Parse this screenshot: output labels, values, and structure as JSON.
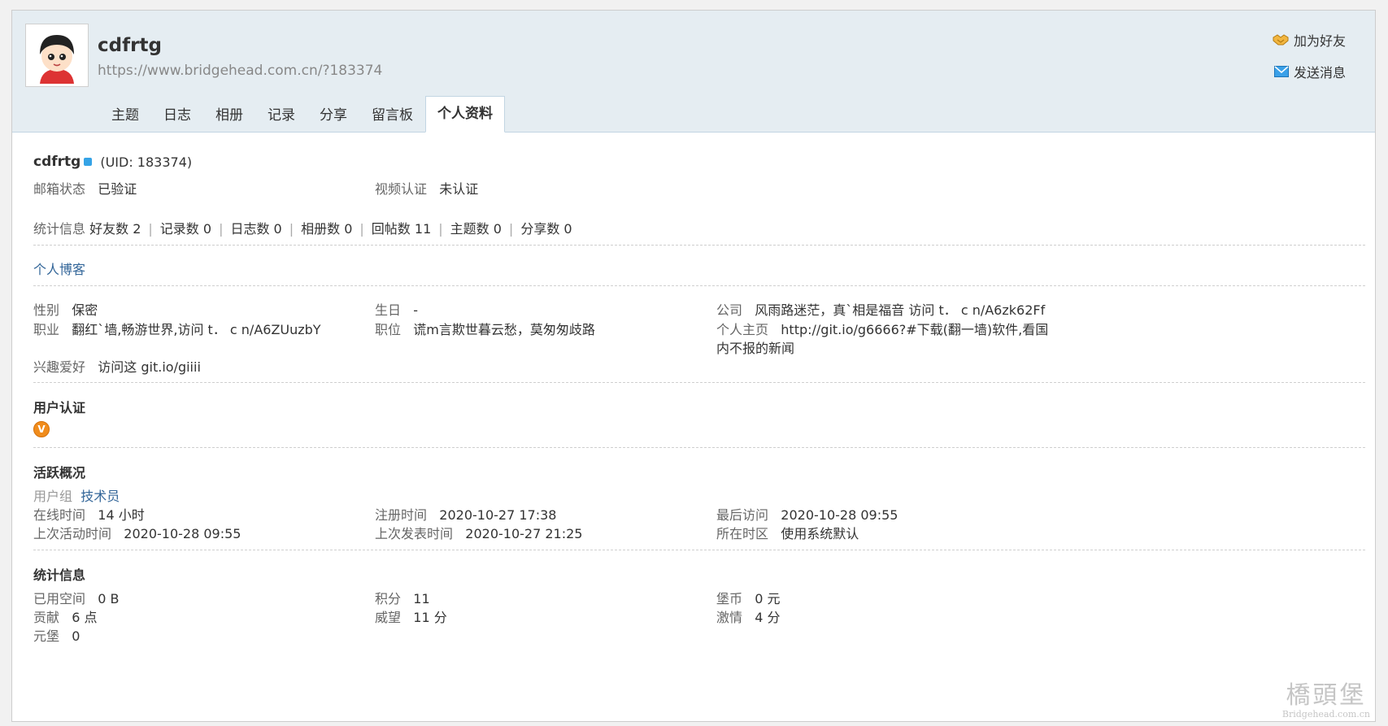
{
  "header": {
    "username": "cdfrtg",
    "url": "https://www.bridgehead.com.cn/?183374",
    "actions": {
      "add_friend": "加为好友",
      "send_message": "发送消息"
    },
    "tabs": [
      "主题",
      "日志",
      "相册",
      "记录",
      "分享",
      "留言板",
      "个人资料"
    ],
    "active_tab": "个人资料"
  },
  "profile": {
    "name": "cdfrtg",
    "uid": "(UID: 183374)",
    "email_status_label": "邮箱状态",
    "email_status_value": "已验证",
    "video_label": "视频认证",
    "video_value": "未认证",
    "stats_label": "统计信息",
    "stats": [
      "好友数 2",
      "记录数 0",
      "日志数 0",
      "相册数 0",
      "回帖数 11",
      "主题数 0",
      "分享数 0"
    ],
    "blog_link": "个人博客",
    "gender_label": "性别",
    "gender_value": "保密",
    "birthday_label": "生日",
    "birthday_value": "-",
    "company_label": "公司",
    "company_value": "风雨路迷茫，真`相是福音 访问 t． c n/A6zk62Ff",
    "job_label": "职业",
    "job_value": "翻红`墙,畅游世界,访问 t． c n/A6ZUuzbY",
    "position_label": "职位",
    "position_value": "谎m言欺世暮云愁，莫匆匆歧路",
    "homepage_label": "个人主页",
    "homepage_value_1": "http://git.io/g6666?#下载(翻一墙)软件,看国",
    "homepage_value_2": "内不报的新闻",
    "hobby_label": "兴趣爱好",
    "hobby_value": "访问这 git.io/giiii"
  },
  "cert": {
    "title": "用户认证",
    "badge": "V",
    "badge_color": "#f08c1c"
  },
  "activity": {
    "title": "活跃概况",
    "group_label": "用户组",
    "group_value": "技术员",
    "online_label": "在线时间",
    "online_value": "14 小时",
    "reg_label": "注册时间",
    "reg_value": "2020-10-27 17:38",
    "last_visit_label": "最后访问",
    "last_visit_value": "2020-10-28 09:55",
    "last_active_label": "上次活动时间",
    "last_active_value": "2020-10-28 09:55",
    "last_post_label": "上次发表时间",
    "last_post_value": "2020-10-27 21:25",
    "timezone_label": "所在时区",
    "timezone_value": "使用系统默认"
  },
  "statistics": {
    "title": "统计信息",
    "space_label": "已用空间",
    "space_value": "0 B",
    "points_label": "积分",
    "points_value": "11",
    "coin_label": "堡币",
    "coin_value": "0 元",
    "contrib_label": "贡献",
    "contrib_value": "6 点",
    "prestige_label": "威望",
    "prestige_value": "11 分",
    "passion_label": "激情",
    "passion_value": "4 分",
    "yuanbao_label": "元堡",
    "yuanbao_value": "0"
  },
  "watermark": {
    "text_1": "橋頭堡",
    "text_2": "Bridgehead.com.cn"
  },
  "colors": {
    "header_bg": "#e5edf2",
    "link": "#336699",
    "badge": "#f08c1c"
  }
}
